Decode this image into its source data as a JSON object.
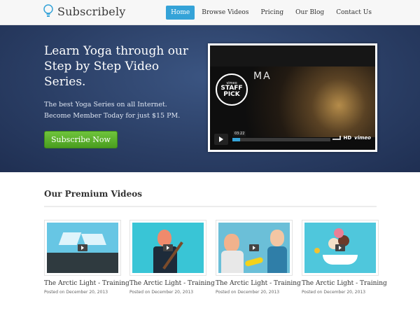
{
  "header": {
    "logo_text": "Subscribely",
    "logo_icon": "lightbulb-icon",
    "nav": [
      {
        "label": "Home",
        "active": true
      },
      {
        "label": "Browse Videos",
        "active": false
      },
      {
        "label": "Pricing",
        "active": false
      },
      {
        "label": "Our Blog",
        "active": false
      },
      {
        "label": "Contact Us",
        "active": false
      }
    ]
  },
  "hero": {
    "title": "Learn Yoga through our Step by Step Video Series.",
    "subtitle_line1": "The best Yoga Series on all Internet.",
    "subtitle_line2": "Become Member Today for just $15 PM.",
    "cta_label": "Subscribe Now",
    "video": {
      "badge_top": "vimeo",
      "badge_main": "STAFF PICK",
      "overlay_text": "MA",
      "timestamp": "03:22",
      "hd_label": "HD",
      "brand_label": "vimeo",
      "progress_fraction": 0.08
    }
  },
  "premium": {
    "heading": "Our Premium Videos",
    "cards": [
      {
        "title": "The Arctic Light - Training",
        "date": "Posted on December 20, 2013"
      },
      {
        "title": "The Arctic Light - Training",
        "date": "Posted on December 20, 2013"
      },
      {
        "title": "The Arctic Light - Training",
        "date": "Posted on December 20, 2013"
      },
      {
        "title": "The Arctic Light - Training",
        "date": "Posted on December 20, 2013"
      }
    ]
  },
  "colors": {
    "accent": "#35a3d8",
    "cta_green": "#5cb22e",
    "hero_bg": "#2b3f66",
    "thumb_bg": "#37c3d8"
  }
}
